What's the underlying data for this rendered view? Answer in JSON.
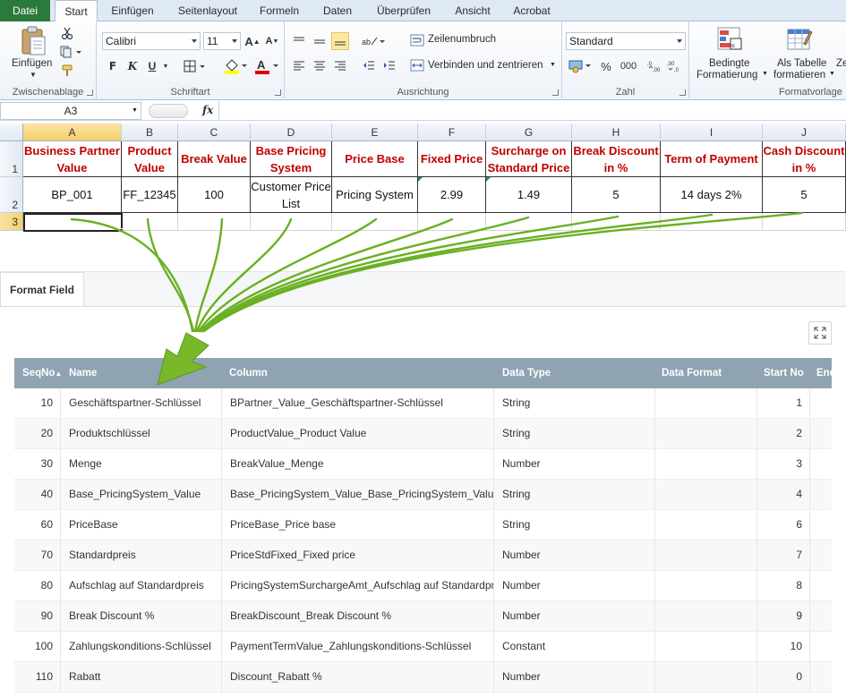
{
  "ribbon_tabs": [
    "Datei",
    "Start",
    "Einfügen",
    "Seitenlayout",
    "Formeln",
    "Daten",
    "Überprüfen",
    "Ansicht",
    "Acrobat"
  ],
  "ribbon": {
    "paste_label": "Einfügen",
    "clipboard_group": "Zwischenablage",
    "font_group": "Schriftart",
    "font_name": "Calibri",
    "font_size": "11",
    "bold": "F",
    "italic": "K",
    "underline": "U",
    "alignment_group": "Ausrichtung",
    "wrap_text": "Zeilenumbruch",
    "merge_center": "Verbinden und zentrieren",
    "number_group": "Zahl",
    "number_format": "Standard",
    "percent": "%",
    "thousands": "000",
    "cond_format_line1": "Bedingte",
    "cond_format_line2": "Formatierung",
    "as_table_line1": "Als Tabelle",
    "as_table_line2": "formatieren",
    "cell_styles_partial": "Ze",
    "styles_group": "Formatvorlage"
  },
  "formula_bar": {
    "name_box": "A3",
    "fx": "fx",
    "formula": ""
  },
  "sheet": {
    "columns": [
      "A",
      "B",
      "C",
      "D",
      "E",
      "F",
      "G",
      "H",
      "I",
      "J"
    ],
    "rows": [
      "1",
      "2",
      "3"
    ],
    "headers": [
      "Business Partner Value",
      "Product Value",
      "Break Value",
      "Base Pricing System",
      "Price Base",
      "Fixed Price",
      "Surcharge on Standard Price",
      "Break Discount in %",
      "Term of Payment",
      "Cash Discount in %"
    ],
    "values": [
      "BP_001",
      "FF_12345",
      "100",
      "Customer Price List",
      "Pricing System",
      "2.99",
      "1.49",
      "5",
      "14 days 2%",
      "5"
    ]
  },
  "panel": {
    "tab_label": "Format Field",
    "columns": [
      "SeqNo",
      "Name",
      "Column",
      "Data Type",
      "Data Format",
      "Start No",
      "End"
    ],
    "sort_indicator": "▲",
    "rows": [
      {
        "seq": "10",
        "name": "Geschäftspartner-Schlüssel",
        "column": "BPartner_Value_Geschäftspartner-Schlüssel",
        "type": "String",
        "format": "",
        "start": "1"
      },
      {
        "seq": "20",
        "name": "Produktschlüssel",
        "column": "ProductValue_Product Value",
        "type": "String",
        "format": "",
        "start": "2"
      },
      {
        "seq": "30",
        "name": "Menge",
        "column": "BreakValue_Menge",
        "type": "Number",
        "format": "",
        "start": "3"
      },
      {
        "seq": "40",
        "name": "Base_PricingSystem_Value",
        "column": "Base_PricingSystem_Value_Base_PricingSystem_Value",
        "type": "String",
        "format": "",
        "start": "4"
      },
      {
        "seq": "60",
        "name": "PriceBase",
        "column": "PriceBase_Price base",
        "type": "String",
        "format": "",
        "start": "6"
      },
      {
        "seq": "70",
        "name": "Standardpreis",
        "column": "PriceStdFixed_Fixed price",
        "type": "Number",
        "format": "",
        "start": "7"
      },
      {
        "seq": "80",
        "name": "Aufschlag auf Standardpreis",
        "column": "PricingSystemSurchargeAmt_Aufschlag auf Standardpreis",
        "type": "Number",
        "format": "",
        "start": "8"
      },
      {
        "seq": "90",
        "name": "Break Discount %",
        "column": "BreakDiscount_Break Discount %",
        "type": "Number",
        "format": "",
        "start": "9"
      },
      {
        "seq": "100",
        "name": "Zahlungskonditions-Schlüssel",
        "column": "PaymentTermValue_Zahlungskonditions-Schlüssel",
        "type": "Constant",
        "format": "",
        "start": "10"
      },
      {
        "seq": "110",
        "name": "Rabatt",
        "column": "Discount_Rabatt %",
        "type": "Number",
        "format": "",
        "start": "0"
      }
    ]
  },
  "colors": {
    "file_tab": "#2a7a3b",
    "header_text": "#c00000",
    "arrow": "#6ab023",
    "grid_header": "#8fa3b1"
  }
}
